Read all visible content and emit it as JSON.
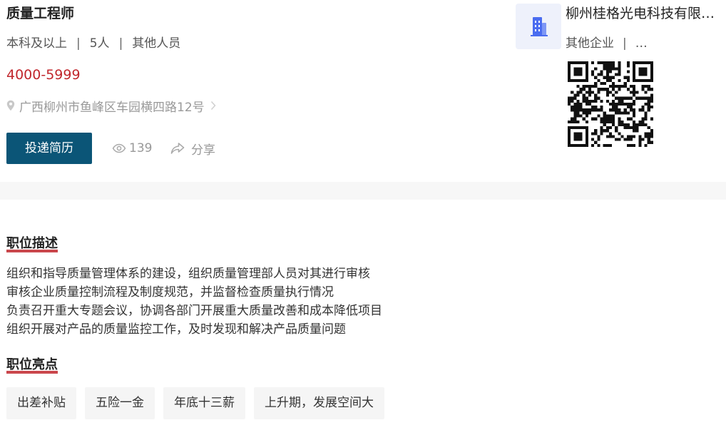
{
  "job": {
    "title": "质量工程师",
    "education": "本科及以上",
    "separator": "|",
    "headcount": "5人",
    "category": "其他人员",
    "salary": "4000-5999",
    "address": "广西柳州市鱼峰区车园横四路12号",
    "apply_label": "投递简历",
    "views": "139",
    "share_label": "分享"
  },
  "company": {
    "name": "柳州桂格光电科技有限公司",
    "type": "其他企业",
    "more": "…"
  },
  "description": {
    "title": "职位描述",
    "lines": [
      "组织和指导质量管理体系的建设，组织质量管理部人员对其进行审核",
      "审核企业质量控制流程及制度规范，并监督检查质量执行情况",
      "负责召开重大专题会议，协调各部门开展重大质量改善和成本降低项目",
      "组织开展对产品的质量监控工作，及时发现和解决产品质量问题"
    ]
  },
  "highlights": {
    "title": "职位亮点",
    "tags": [
      "出差补贴",
      "五险一金",
      "年底十三薪",
      "上升期，发展空间大"
    ]
  },
  "colors": {
    "accent": "#c1272d",
    "button": "#0b5577",
    "logo_bg": "#eef1fb",
    "logo_icon": "#4a6cf0"
  },
  "icons": {
    "location": "location-pin-icon",
    "chevron": "chevron-right-icon",
    "views": "eye-icon",
    "share": "share-arrow-icon",
    "logo": "building-icon"
  }
}
